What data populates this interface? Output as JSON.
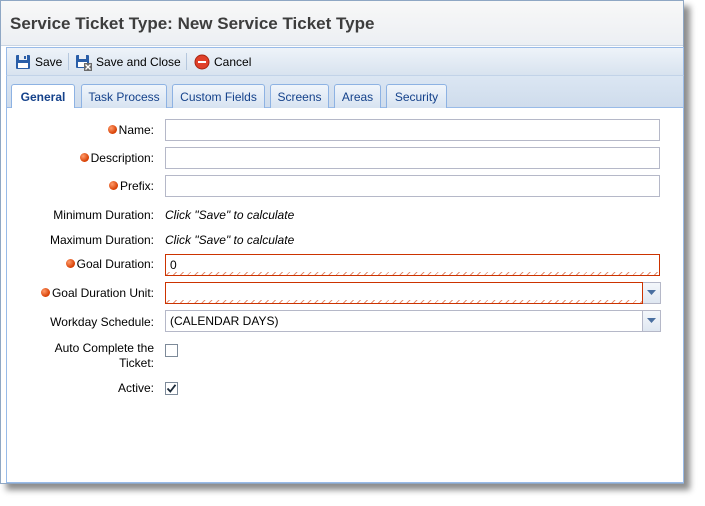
{
  "title": "Service Ticket Type: New Service Ticket Type",
  "toolbar": {
    "save_label": "Save",
    "save_close_label": "Save and Close",
    "cancel_label": "Cancel"
  },
  "tabs": [
    {
      "label": "General",
      "active": true
    },
    {
      "label": "Task Process"
    },
    {
      "label": "Custom Fields"
    },
    {
      "label": "Screens"
    },
    {
      "label": "Areas"
    },
    {
      "label": "Security"
    }
  ],
  "form": {
    "name": {
      "label": "Name:",
      "value": "",
      "required": true
    },
    "description": {
      "label": "Description:",
      "value": "",
      "required": true
    },
    "prefix": {
      "label": "Prefix:",
      "value": "",
      "required": true
    },
    "min_duration": {
      "label": "Minimum Duration:",
      "value": "Click \"Save\" to calculate"
    },
    "max_duration": {
      "label": "Maximum Duration:",
      "value": "Click \"Save\" to calculate"
    },
    "goal_duration": {
      "label": "Goal Duration:",
      "value": "0",
      "required": true
    },
    "goal_duration_unit": {
      "label": "Goal Duration Unit:",
      "value": "",
      "required": true
    },
    "workday_schedule": {
      "label": "Workday Schedule:",
      "value": "(CALENDAR DAYS)"
    },
    "auto_complete": {
      "label_line1": "Auto Complete the",
      "label_line2": "Ticket:",
      "checked": false
    },
    "active": {
      "label": "Active:",
      "checked": true
    }
  },
  "colors": {
    "required_dot": "#d63d00",
    "invalid_border": "#cc3300",
    "tab_text": "#15428b",
    "panel_border": "#99bbe8"
  },
  "icons": {
    "save": "floppy-disk-icon",
    "save_close": "floppy-close-icon",
    "cancel": "cancel-circle-icon",
    "dropdown": "chevron-down-icon",
    "check": "checkmark-icon"
  }
}
